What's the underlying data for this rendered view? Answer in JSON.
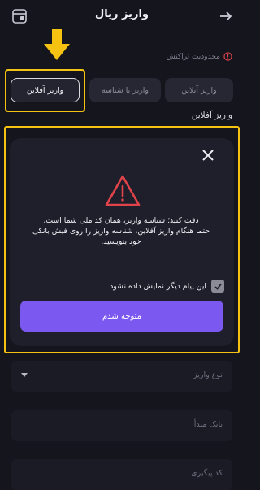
{
  "header": {
    "title": "واریز ریال"
  },
  "limit": {
    "text": "محدودیت تراکنش"
  },
  "tabs": [
    {
      "label": "واریز آنلاین"
    },
    {
      "label": "واریز با شناسه"
    },
    {
      "label": "واریز آفلاین"
    }
  ],
  "section": {
    "title": "واریز آفلاین"
  },
  "modal": {
    "line1": "دقت کنید؛ شناسه واریز، همان کد ملی شما است.",
    "line2": "حتما هنگام واریز آفلاین، شناسه واریز را روی فیش بانکی",
    "line3": "خود بنویسید.",
    "checkbox_label": "این پیام دیگر نمایش داده نشود",
    "confirm_label": "متوجه شدم"
  },
  "form": {
    "deposit_type": "نوع واریز",
    "source_bank": "بانک مبدأ",
    "tracking_code": "کد پیگیری"
  },
  "colors": {
    "accent": "#7b59f0",
    "highlight": "#f5c212",
    "warning": "#e0444a"
  }
}
